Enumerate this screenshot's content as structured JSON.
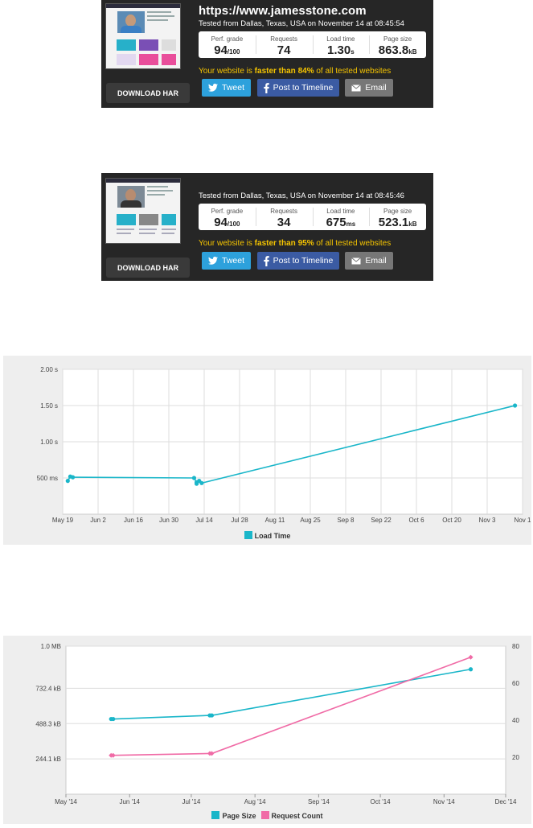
{
  "card1": {
    "url": "https://www.jamesstone.com",
    "tested": "Tested from Dallas, Texas, USA on November 14 at 08:45:54",
    "metrics": [
      {
        "label": "Perf. grade",
        "value": "94",
        "unit": "/100"
      },
      {
        "label": "Requests",
        "value": "74",
        "unit": ""
      },
      {
        "label": "Load time",
        "value": "1.30",
        "unit": "s"
      },
      {
        "label": "Page size",
        "value": "863.8",
        "unit": "kB"
      }
    ],
    "faster_pre": "Your website is ",
    "faster_bold": "faster than 84%",
    "faster_post": " of all tested websites",
    "download": "DOWNLOAD HAR",
    "tweet": "Tweet",
    "fb": "Post to Timeline",
    "email": "Email"
  },
  "card2": {
    "tested": "Tested from Dallas, Texas, USA on November 14 at 08:45:46",
    "metrics": [
      {
        "label": "Perf. grade",
        "value": "94",
        "unit": "/100"
      },
      {
        "label": "Requests",
        "value": "34",
        "unit": ""
      },
      {
        "label": "Load time",
        "value": "675",
        "unit": "ms"
      },
      {
        "label": "Page size",
        "value": "523.1",
        "unit": "kB"
      }
    ],
    "faster_pre": "Your website is ",
    "faster_bold": "faster than 95%",
    "faster_post": " of all tested websites",
    "download": "DOWNLOAD HAR",
    "tweet": "Tweet",
    "fb": "Post to Timeline",
    "email": "Email"
  },
  "chart_data": [
    {
      "type": "line",
      "x_ticks": [
        "May 19",
        "Jun 2",
        "Jun 16",
        "Jun 30",
        "Jul 14",
        "Jul 28",
        "Aug 11",
        "Aug 25",
        "Sep 8",
        "Sep 22",
        "Oct 6",
        "Oct 20",
        "Nov 3",
        "Nov 1"
      ],
      "y_ticks": [
        "2.00 s",
        "1.50 s",
        "1.00 s",
        "500 ms"
      ],
      "ylim": [
        0,
        2000
      ],
      "grid": true,
      "legend_position": "bottom",
      "series": [
        {
          "name": "Load Time",
          "color": "#1ab6c9",
          "points": [
            {
              "x": "2014-05-21",
              "y": 460
            },
            {
              "x": "2014-05-22",
              "y": 520
            },
            {
              "x": "2014-05-23",
              "y": 510
            },
            {
              "x": "2014-07-10",
              "y": 500
            },
            {
              "x": "2014-07-11",
              "y": 440
            },
            {
              "x": "2014-07-11",
              "y": 420
            },
            {
              "x": "2014-07-12",
              "y": 460
            },
            {
              "x": "2014-07-13",
              "y": 430
            },
            {
              "x": "2014-11-14",
              "y": 1500
            }
          ]
        }
      ]
    },
    {
      "type": "line",
      "x_ticks": [
        "May '14",
        "Jun '14",
        "Jul '14",
        "Aug '14",
        "Sep '14",
        "Oct '14",
        "Nov '14",
        "Dec '14"
      ],
      "y_left_ticks": [
        "1.0 MB",
        "732.4 kB",
        "488.3 kB",
        "244.1 kB"
      ],
      "y_right_ticks": [
        "80",
        "60",
        "40",
        "20"
      ],
      "y_left_lim_kb": [
        0,
        1024
      ],
      "y_right_lim": [
        0,
        80
      ],
      "grid": true,
      "legend_position": "bottom",
      "series": [
        {
          "name": "Page Size",
          "axis": "left",
          "color": "#1ab6c9",
          "points": [
            {
              "x": "2014-05-23",
              "y": 520
            },
            {
              "x": "2014-05-24",
              "y": 520
            },
            {
              "x": "2014-07-10",
              "y": 545
            },
            {
              "x": "2014-07-11",
              "y": 545
            },
            {
              "x": "2014-11-14",
              "y": 864
            }
          ]
        },
        {
          "name": "Request Count",
          "axis": "right",
          "color": "#f06ba6",
          "points": [
            {
              "x": "2014-05-23",
              "y": 21
            },
            {
              "x": "2014-05-24",
              "y": 21
            },
            {
              "x": "2014-07-10",
              "y": 22
            },
            {
              "x": "2014-07-11",
              "y": 22
            },
            {
              "x": "2014-11-14",
              "y": 74
            }
          ]
        }
      ]
    }
  ]
}
